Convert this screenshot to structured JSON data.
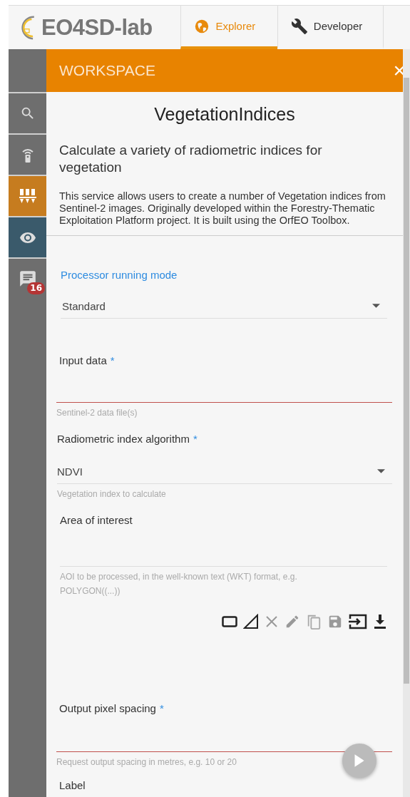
{
  "logo": {
    "text": "EO4SD-lab"
  },
  "tabs": [
    {
      "label": "Explorer",
      "selected": true
    },
    {
      "label": "Developer",
      "selected": false
    }
  ],
  "sidebar": {
    "items": [
      {
        "color": "#6e6e6e"
      },
      {
        "color": "#6e6e6e"
      },
      {
        "color": "#c67c1f"
      },
      {
        "color": "#3a5a6b"
      },
      {
        "color": "#6e6e6e",
        "badge": "16"
      }
    ]
  },
  "panel": {
    "header": "WORKSPACE",
    "close": "×",
    "title": "VegetationIndices",
    "subtitle": "Calculate a variety of radiometric indices for vegetation",
    "description": "This service allows users to create a number of Vegetation indices from Sentinel-2 images. Originally developed within the Forestry-Thematic Exploitation Platform project. It is built using the OrfEO Toolbox."
  },
  "fields": [
    {
      "kind": "select",
      "label": "Processor running mode",
      "focused": true,
      "value": "Standard"
    },
    {
      "kind": "text",
      "label": "Input data",
      "focused": false,
      "required_mark": "*",
      "invalid": true,
      "hint": "Sentinel-2 data file(s)"
    },
    {
      "kind": "select",
      "label": "Radiometric index algorithm",
      "focused": false,
      "required_mark": "*",
      "value": "NDVI",
      "hint": "Vegetation index to calculate"
    },
    {
      "kind": "area",
      "label": "Area of interest",
      "focused": false,
      "hint": "AOI to be processed, in the well-known text (WKT) format, e.g. POLYGON((...))"
    },
    {
      "kind": "text",
      "label": "Output pixel spacing",
      "focused": false,
      "required_mark": "*",
      "invalid": true,
      "hint": "Request output spacing in metres, e.g. 10 or 20"
    },
    {
      "kind": "cut",
      "label": "Label",
      "focused": false
    }
  ]
}
